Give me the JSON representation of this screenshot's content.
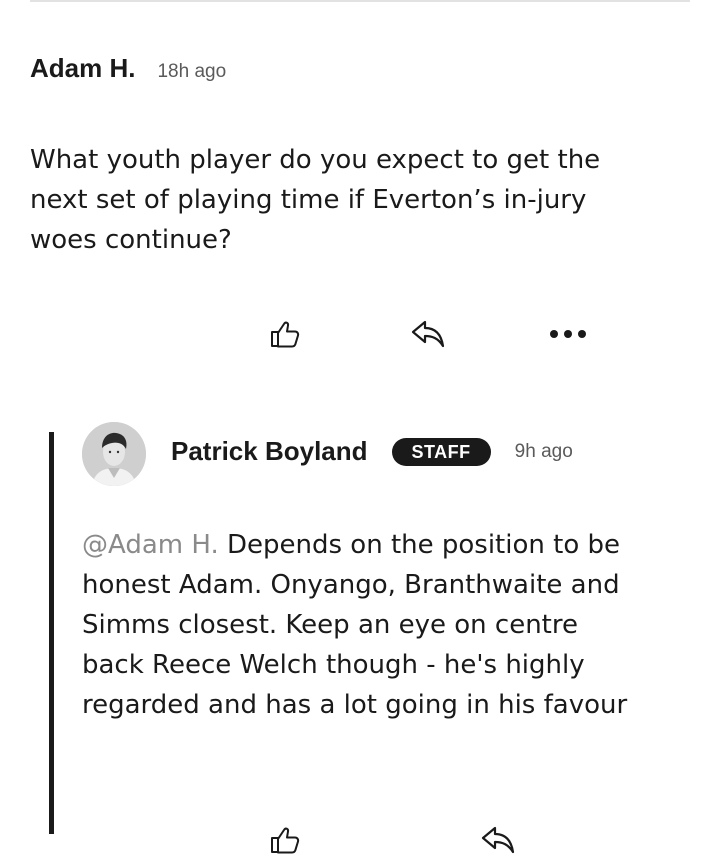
{
  "comment": {
    "author": "Adam H.",
    "time": "18h ago",
    "body": "What youth player do you expect to get the next set of playing time if Everton’s in-jury woes continue?",
    "actions": {
      "like_icon": "thumbs-up-icon",
      "reply_icon": "reply-arrow-icon",
      "more_icon": "more-dots-icon"
    }
  },
  "reply": {
    "avatar_icon": "avatar-photo",
    "author": "Patrick Boyland",
    "badge": "STAFF",
    "time": "9h ago",
    "mention": "@Adam H.",
    "body": "Depends on the position to be honest Adam. Onyango, Branthwaite and Simms closest. Keep an eye on centre back Reece Welch though - he's highly regarded and has a lot going in his favour",
    "actions": {
      "like_icon": "thumbs-up-icon",
      "reply_icon": "reply-arrow-icon"
    }
  },
  "colors": {
    "text": "#1a1a1a",
    "muted": "#5a5a5a",
    "mention": "#8a8a8a",
    "badge_bg": "#1a1a1a",
    "badge_text": "#ffffff"
  }
}
